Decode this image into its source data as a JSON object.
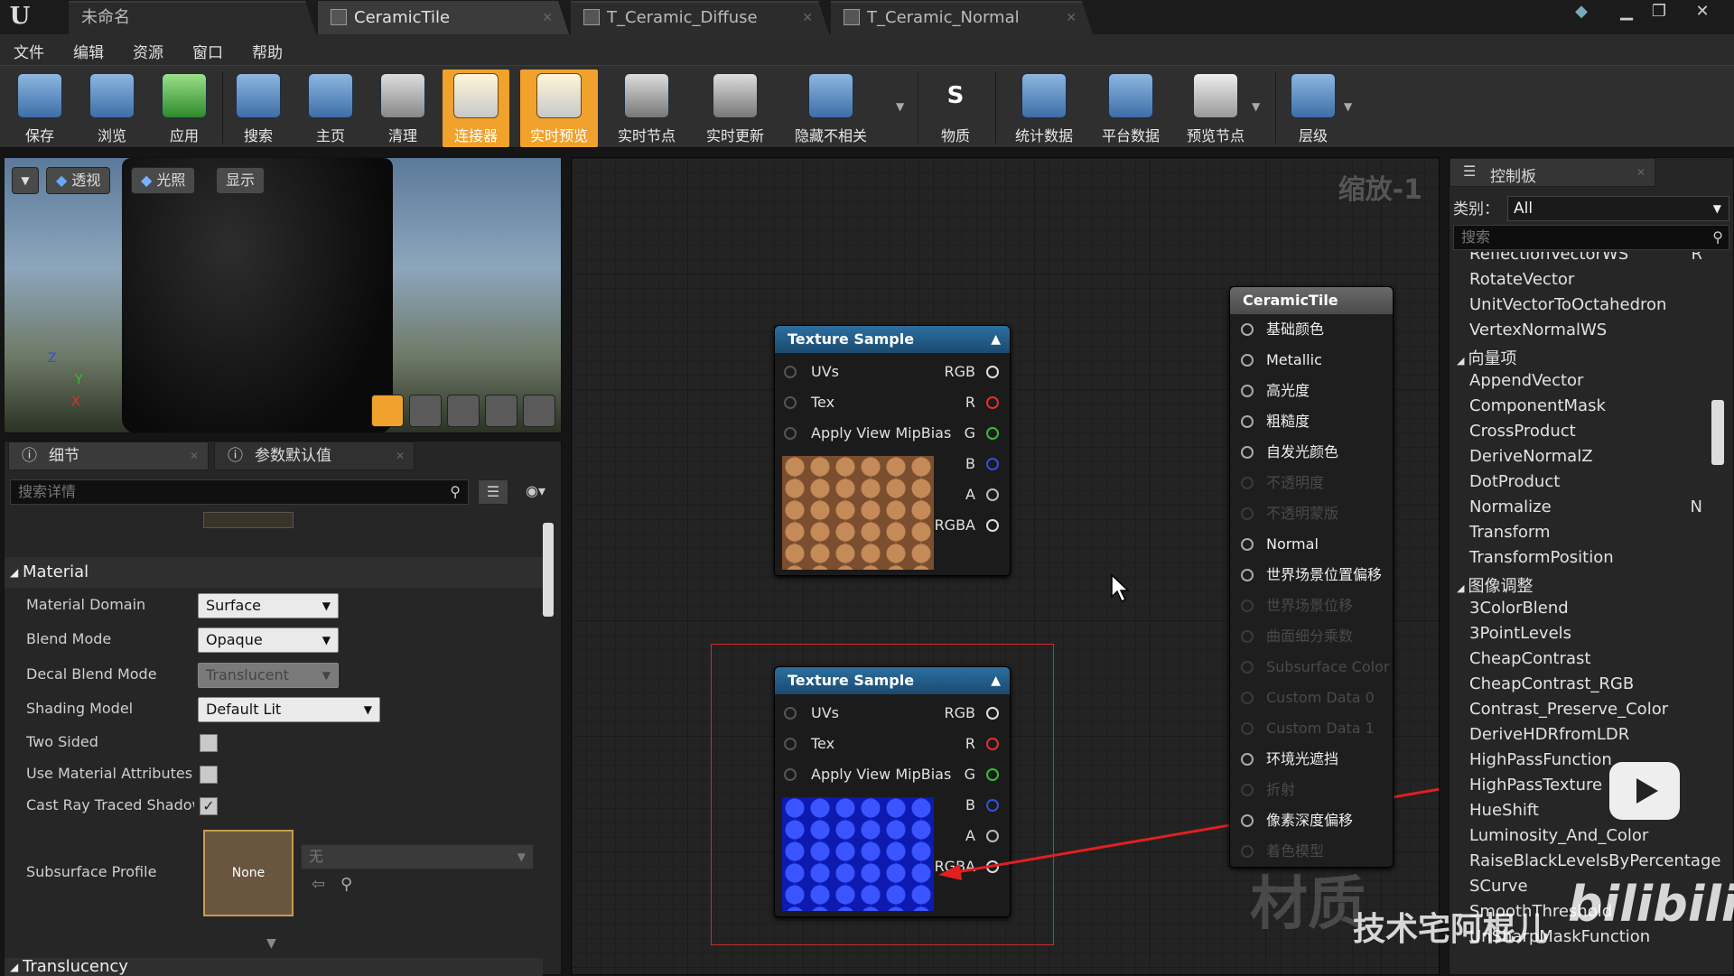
{
  "tabs": [
    {
      "label": "未命名"
    },
    {
      "label": "CeramicTile"
    },
    {
      "label": "T_Ceramic_Diffuse"
    },
    {
      "label": "T_Ceramic_Normal"
    }
  ],
  "menu": [
    "文件",
    "编辑",
    "资源",
    "窗口",
    "帮助"
  ],
  "toolbar": [
    "保存",
    "浏览",
    "应用",
    "搜索",
    "主页",
    "清理",
    "连接器",
    "实时预览",
    "实时节点",
    "实时更新",
    "隐藏不相关",
    "物质",
    "统计数据",
    "平台数据",
    "预览节点",
    "层级"
  ],
  "viewport": {
    "view_btn": "透视",
    "lit_btn": "光照",
    "show_btn": "显示",
    "axis_z": "Z",
    "axis_y": "Y",
    "axis_x": "X"
  },
  "details": {
    "tab1": "细节",
    "tab2": "参数默认值",
    "search_placeholder": "搜索详情",
    "section_material": "Material",
    "section_translucency": "Translucency",
    "rows": [
      {
        "label": "Material Domain",
        "value": "Surface"
      },
      {
        "label": "Blend Mode",
        "value": "Opaque"
      },
      {
        "label": "Decal Blend Mode",
        "value": "Translucent"
      },
      {
        "label": "Shading Model",
        "value": "Default Lit"
      },
      {
        "label": "Two Sided"
      },
      {
        "label": "Use Material Attributes"
      },
      {
        "label": "Cast Ray Traced Shadows"
      },
      {
        "label": "Subsurface Profile",
        "thumb": "None",
        "value": "无"
      }
    ]
  },
  "graph": {
    "zoom": "缩放-1"
  },
  "texture_nodes": [
    {
      "title": "Texture Sample",
      "inputs": [
        "UVs",
        "Tex",
        "Apply View MipBias"
      ],
      "outputs": [
        "RGB",
        "R",
        "G",
        "B",
        "A",
        "RGBA"
      ]
    },
    {
      "title": "Texture Sample",
      "inputs": [
        "UVs",
        "Tex",
        "Apply View MipBias"
      ],
      "outputs": [
        "RGB",
        "R",
        "G",
        "B",
        "A",
        "RGBA"
      ]
    }
  ],
  "main_node": {
    "title": "CeramicTile",
    "pins": [
      {
        "label": "基础颜色",
        "active": true
      },
      {
        "label": "Metallic",
        "active": true
      },
      {
        "label": "高光度",
        "active": true
      },
      {
        "label": "粗糙度",
        "active": true
      },
      {
        "label": "自发光颜色",
        "active": true
      },
      {
        "label": "不透明度",
        "active": false
      },
      {
        "label": "不透明蒙版",
        "active": false
      },
      {
        "label": "Normal",
        "active": true
      },
      {
        "label": "世界场景位置偏移",
        "active": true
      },
      {
        "label": "世界场景位移",
        "active": false
      },
      {
        "label": "曲面细分乘数",
        "active": false
      },
      {
        "label": "Subsurface Color",
        "active": false
      },
      {
        "label": "Custom Data 0",
        "active": false
      },
      {
        "label": "Custom Data 1",
        "active": false
      },
      {
        "label": "环境光遮挡",
        "active": true
      },
      {
        "label": "折射",
        "active": false
      },
      {
        "label": "像素深度偏移",
        "active": true
      },
      {
        "label": "着色模型",
        "active": false
      }
    ]
  },
  "palette": {
    "title": "控制板",
    "category_label": "类别：",
    "category_value": "All",
    "search_placeholder": "搜索",
    "items": [
      {
        "label": "ReflectionVectorWS",
        "key": "R"
      },
      {
        "label": "RotateVector"
      },
      {
        "label": "UnitVectorToOctahedron"
      },
      {
        "label": "VertexNormalWS"
      },
      {
        "label": "向量项",
        "cat": true
      },
      {
        "label": "AppendVector"
      },
      {
        "label": "ComponentMask"
      },
      {
        "label": "CrossProduct"
      },
      {
        "label": "DeriveNormalZ"
      },
      {
        "label": "DotProduct"
      },
      {
        "label": "Normalize",
        "key": "N"
      },
      {
        "label": "Transform"
      },
      {
        "label": "TransformPosition"
      },
      {
        "label": "图像调整",
        "cat": true
      },
      {
        "label": "3ColorBlend"
      },
      {
        "label": "3PointLevels"
      },
      {
        "label": "CheapContrast"
      },
      {
        "label": "CheapContrast_RGB"
      },
      {
        "label": "Contrast_Preserve_Color"
      },
      {
        "label": "DeriveHDRfromLDR"
      },
      {
        "label": "HighPassFunction"
      },
      {
        "label": "HighPassTexture"
      },
      {
        "label": "HueShift"
      },
      {
        "label": "Luminosity_And_Color"
      },
      {
        "label": "RaiseBlackLevelsByPercentage"
      },
      {
        "label": "SCurve"
      },
      {
        "label": "SmoothThreshold"
      },
      {
        "label": "UnSharpMaskFunction"
      }
    ]
  },
  "watermark": {
    "text": "技术宅阿棍儿",
    "logo": "bilibili",
    "faint": "材质"
  },
  "colors": {
    "accent": "#f0a22c",
    "node_header": "#2c6fa0",
    "selection": "#d22b2b",
    "pin_r": "#e03030",
    "pin_g": "#30c030",
    "pin_b": "#3050e0"
  }
}
